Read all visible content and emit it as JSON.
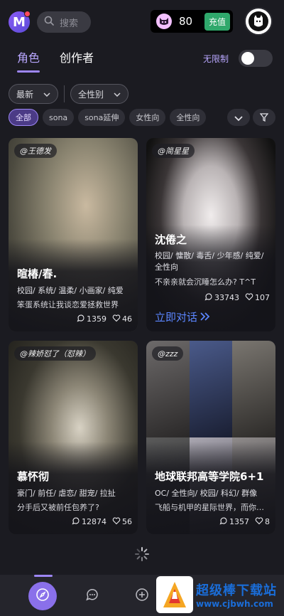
{
  "header": {
    "search_placeholder": "搜索",
    "coins": "80",
    "recharge_label": "充值"
  },
  "tabs": [
    {
      "label": "角色",
      "active": true
    },
    {
      "label": "创作者",
      "active": false
    }
  ],
  "unlimited": {
    "label": "无限制",
    "enabled": false
  },
  "filters": {
    "sort": "最新",
    "gender": "全性别"
  },
  "chips": [
    {
      "label": "全部",
      "active": true
    },
    {
      "label": "sona"
    },
    {
      "label": "sona延伸"
    },
    {
      "label": "女性向"
    },
    {
      "label": "全性向"
    }
  ],
  "cards": [
    {
      "author": "@王德发",
      "title": "暄椿/春.",
      "tags": "校园/ 系统/ 温柔/ 小画家/ 纯爱",
      "desc": "笨蛋系统让我谈恋爱拯救世界",
      "chats": "1359",
      "likes": "46",
      "bg": "#6b6a58"
    },
    {
      "author": "@简星星",
      "title": "沈倦之",
      "tags": "校园/ 慵散/ 毒舌/ 少年感/ 纯爱/ 全性向",
      "desc": "不亲亲就会沉睡怎么办? T^T",
      "chats": "33743",
      "likes": "107",
      "cta": "立即对话",
      "bg": "#c9c5c6"
    },
    {
      "author": "@辣娇怼了（怼辣）",
      "title": "慕怀彻",
      "tags": "豪门/ 前任/ 虐恋/ 甜宠/ 拉扯",
      "desc": "分手后又被前任包养了?",
      "chats": "12874",
      "likes": "56",
      "bg": "#3c3a33"
    },
    {
      "author": "@zzz",
      "title": "地球联邦高等学院6+1",
      "tags": "OC/ 全性向/ 校园/ 科幻/ 群像",
      "desc": "飞船与机甲的星际世界，而你是...",
      "chats": "1357",
      "likes": "8",
      "bg": "#5a5a66"
    }
  ],
  "watermark": {
    "title": "超级棒下载站",
    "url": "www.cjbwh.com"
  }
}
